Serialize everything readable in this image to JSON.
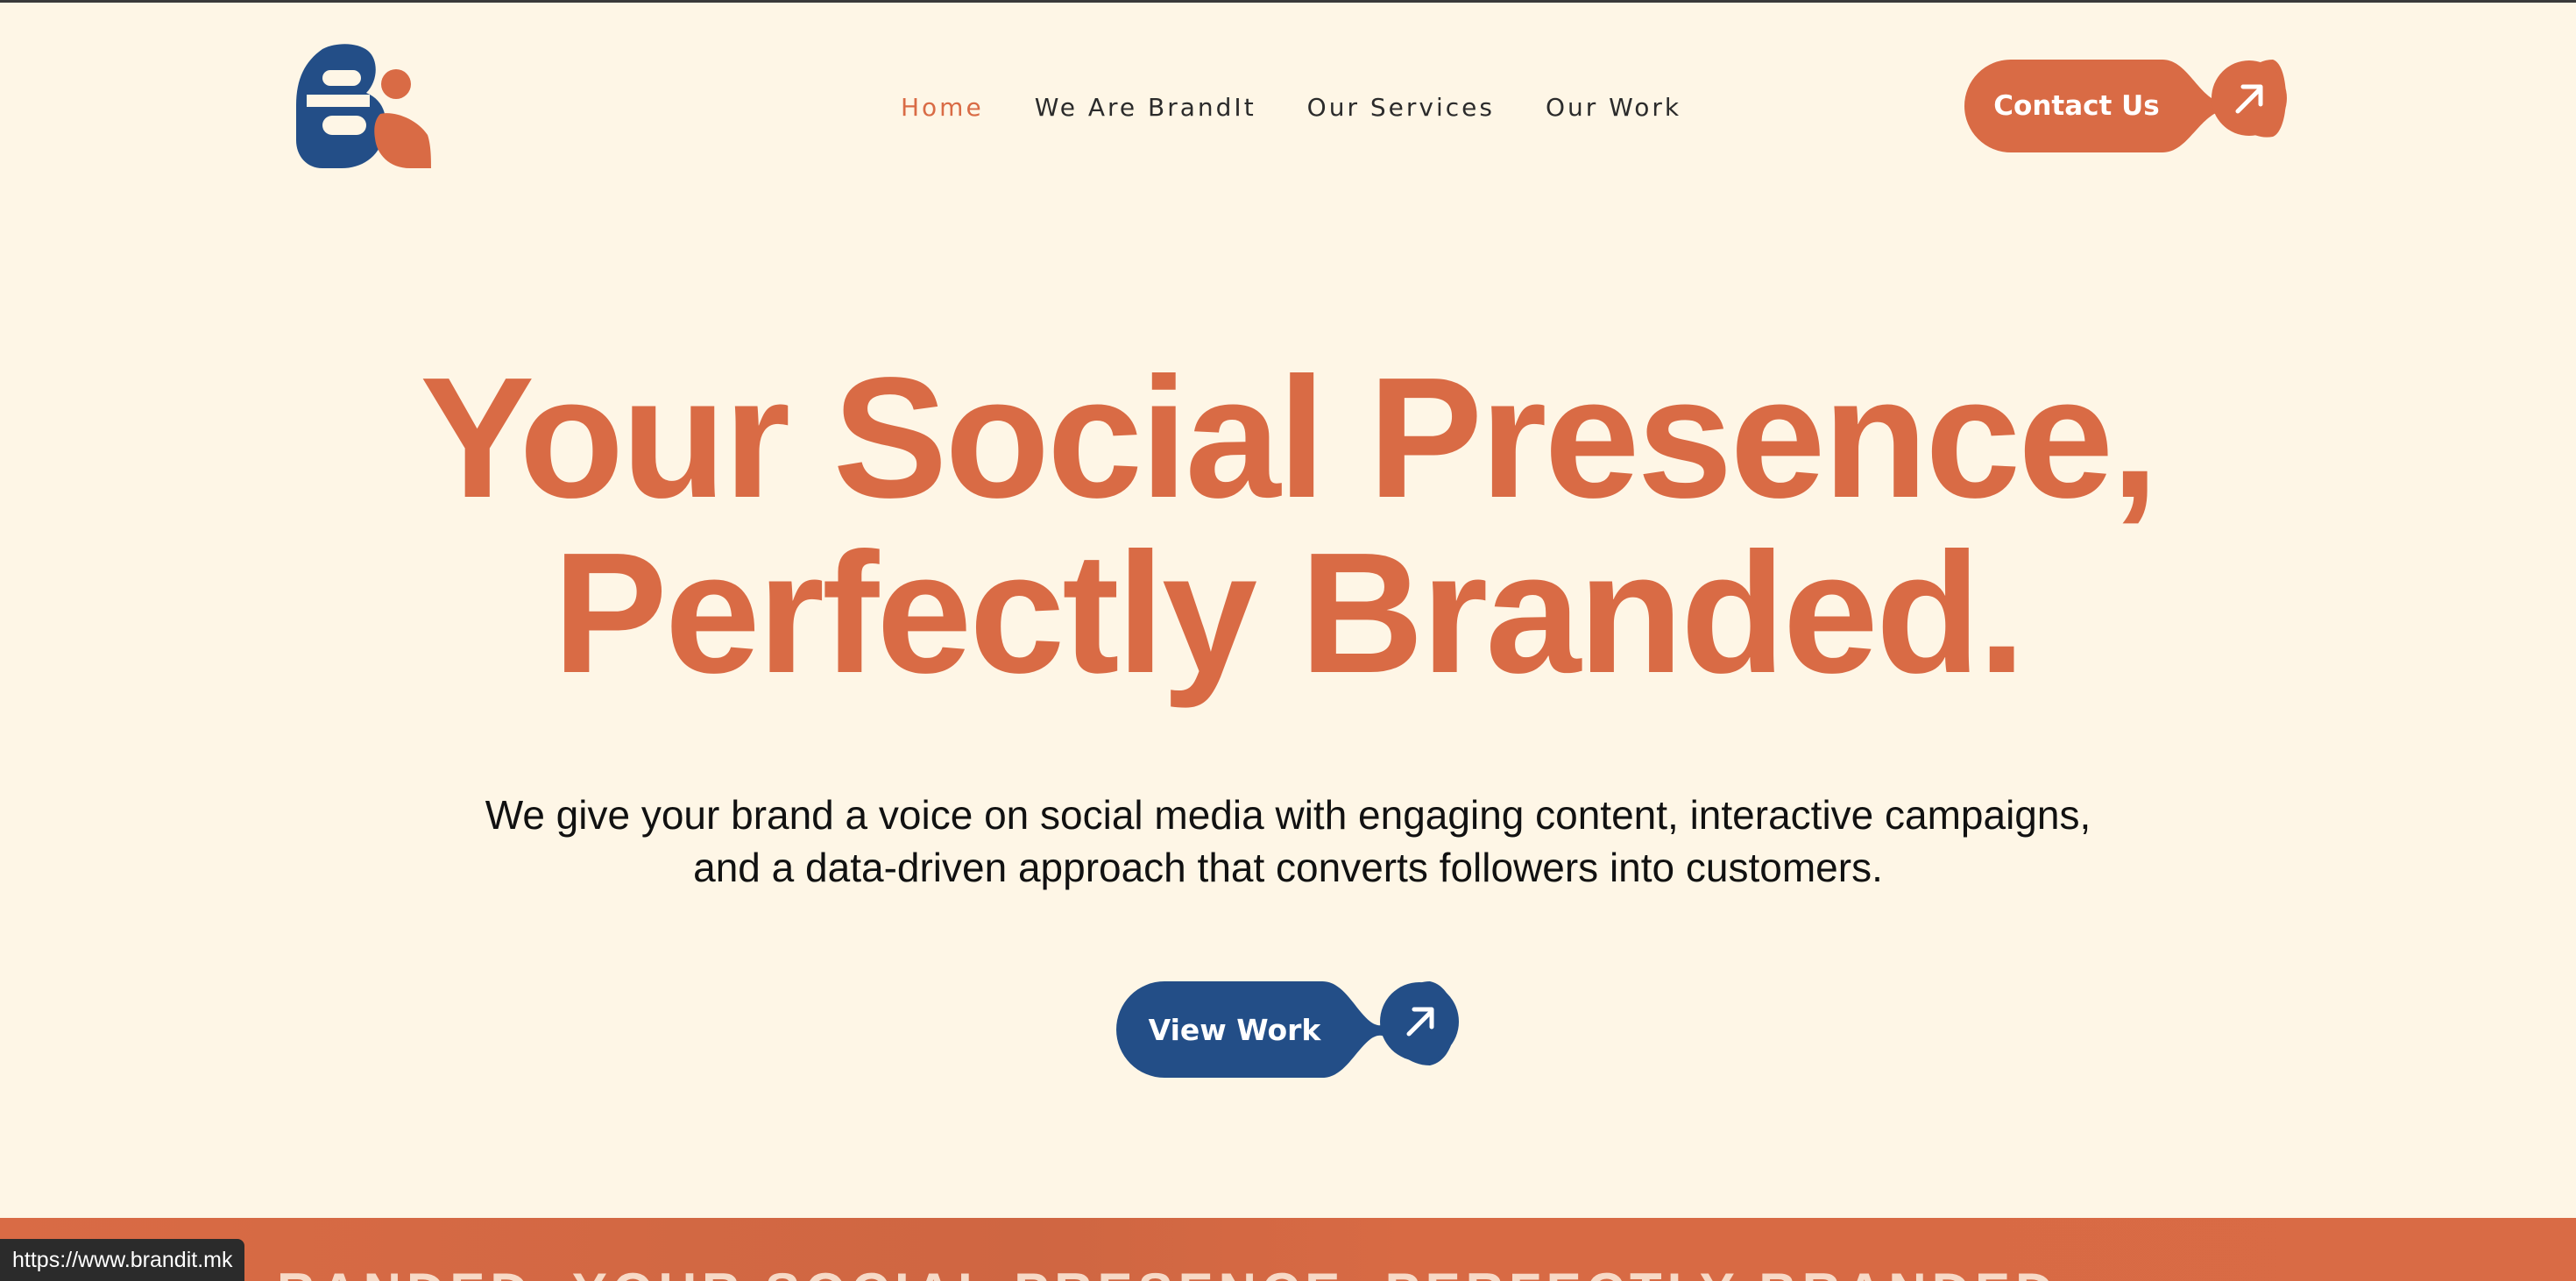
{
  "brand": {
    "logo_alt": "Brandit logo"
  },
  "colors": {
    "accent": "#d96b45",
    "navy": "#234e87",
    "background": "#fef6e6"
  },
  "nav": {
    "items": [
      {
        "label": "Home",
        "active": true
      },
      {
        "label": "We Are BrandIt"
      },
      {
        "label": "Our Services"
      },
      {
        "label": "Our Work"
      }
    ]
  },
  "header": {
    "contact_label": "Contact Us",
    "contact_icon": "arrow-up-right-icon"
  },
  "hero": {
    "title_line1": "Your Social Presence,",
    "title_line2": "Perfectly Branded.",
    "subtitle_line1": "We give your brand a voice on social media with engaging content, interactive campaigns,",
    "subtitle_line2": "and a data-driven approach that converts followers into customers.",
    "cta_label": "View Work",
    "cta_icon": "arrow-up-right-icon"
  },
  "marquee": {
    "text": "RANDED. YOUR SOCIAL PRESENCE, PERFECTLY BRANDED."
  },
  "status_bar": {
    "url": "https://www.brandit.mk"
  }
}
